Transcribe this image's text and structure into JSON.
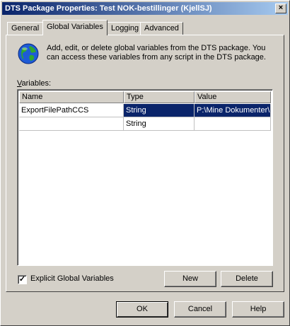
{
  "window": {
    "title": "DTS Package Properties: Test NOK-bestillinger (KjellSJ)",
    "close_glyph": "×"
  },
  "tabs": [
    {
      "label": "General",
      "active": false
    },
    {
      "label": "Global Variables",
      "active": true
    },
    {
      "label": "Logging",
      "active": false
    },
    {
      "label": "Advanced",
      "active": false
    }
  ],
  "panel": {
    "icon": "globe-icon",
    "description": "Add, edit, or delete global variables from the DTS package.  You can access these variables from any script in the DTS package.",
    "variables_label": "Variables:",
    "columns": [
      "Name",
      "Type",
      "Value"
    ],
    "rows": [
      {
        "name": "ExportFilePathCCS",
        "type": "String",
        "value": "P:\\Mine Dokumenter\\"
      },
      {
        "name": "",
        "type": "String",
        "value": ""
      }
    ],
    "explicit_checkbox": {
      "label": "Explicit Global Variables",
      "checked": true,
      "check_glyph": "✓"
    },
    "new_button": "New",
    "delete_button": "Delete"
  },
  "footer": {
    "ok": "OK",
    "cancel": "Cancel",
    "help": "Help"
  },
  "colors": {
    "title_start": "#0a246a",
    "title_end": "#a6caf0",
    "face": "#d4d0c8",
    "selection": "#0a246a"
  }
}
